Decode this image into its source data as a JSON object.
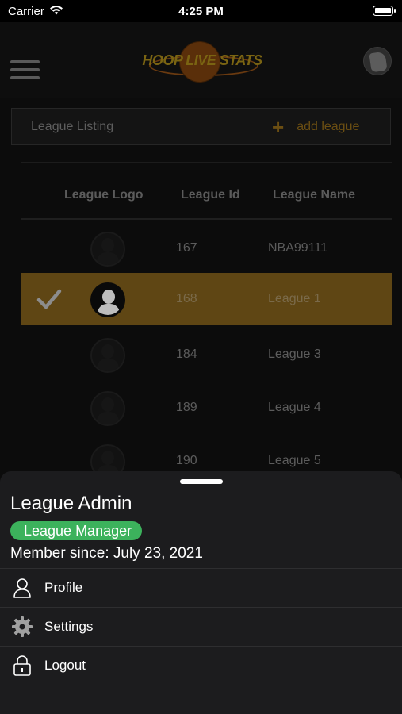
{
  "status_bar": {
    "carrier": "Carrier",
    "time": "4:25 PM"
  },
  "header": {
    "logo_text": "HOOP LIVE STATS"
  },
  "listing": {
    "title": "League Listing",
    "add_label": "add league"
  },
  "table": {
    "headers": [
      "League Logo",
      "League Id",
      "League Name"
    ],
    "rows": [
      {
        "id": "167",
        "name": "NBA99111",
        "selected": false
      },
      {
        "id": "168",
        "name": "League 1",
        "selected": true
      },
      {
        "id": "184",
        "name": "League 3",
        "selected": false
      },
      {
        "id": "189",
        "name": "League 4",
        "selected": false
      },
      {
        "id": "190",
        "name": "League 5",
        "selected": false
      }
    ]
  },
  "sheet": {
    "name": "League Admin",
    "role": "League Manager",
    "member_since": "Member since: July 23, 2021",
    "menu": [
      {
        "label": "Profile",
        "icon": "person-icon"
      },
      {
        "label": "Settings",
        "icon": "gear-icon"
      },
      {
        "label": "Logout",
        "icon": "lock-icon"
      }
    ]
  },
  "colors": {
    "accent": "#5f4614",
    "badge": "#3cb25c",
    "sheet_bg": "#1c1c1e"
  }
}
